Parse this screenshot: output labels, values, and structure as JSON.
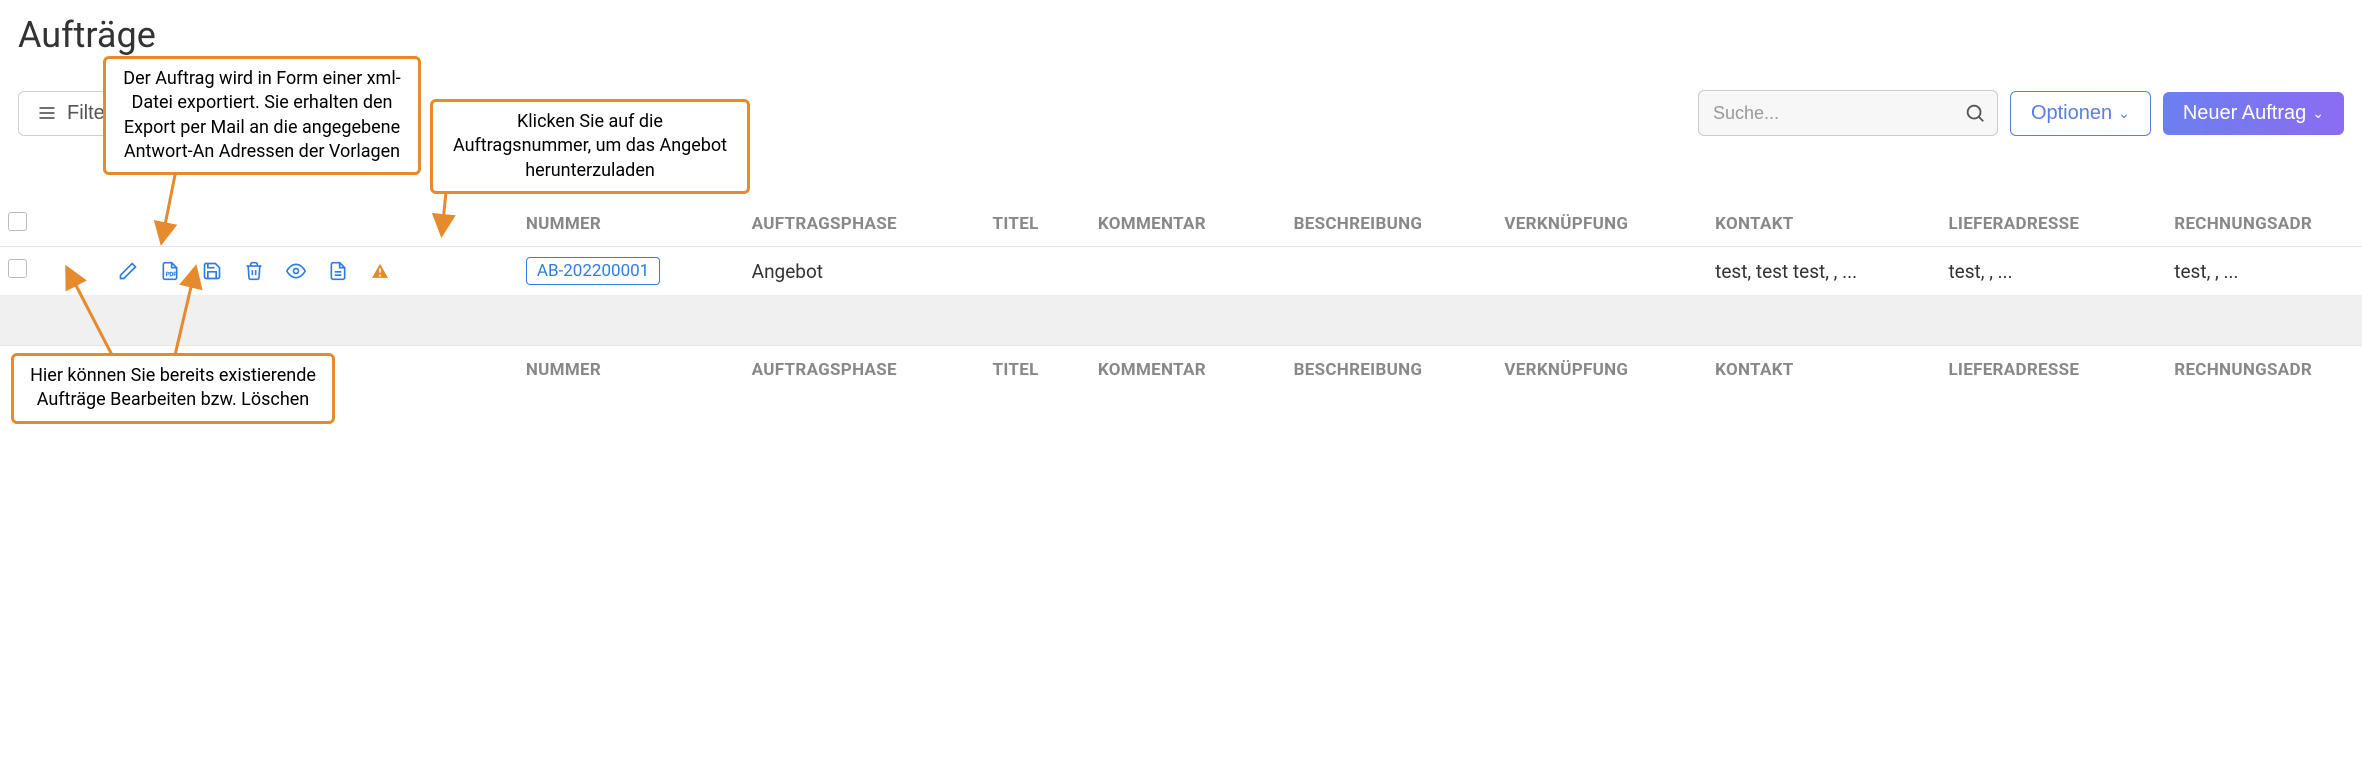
{
  "page": {
    "title": "Aufträge"
  },
  "toolbar": {
    "filter_label": "Filter"
  },
  "search": {
    "placeholder": "Suche..."
  },
  "buttons": {
    "options": "Optionen",
    "new_order": "Neuer Auftrag"
  },
  "columns": {
    "nummer": "NUMMER",
    "phase": "AUFTRAGSPHASE",
    "titel": "TITEL",
    "kommentar": "KOMMENTAR",
    "beschreibung": "BESCHREIBUNG",
    "verknuepfung": "VERKNÜPFUNG",
    "kontakt": "KONTAKT",
    "lieferadresse": "LIEFERADRESSE",
    "rechnungsadresse": "RECHNUNGSADR"
  },
  "rows": [
    {
      "nummer": "AB-202200001",
      "phase": "Angebot",
      "titel": "",
      "kommentar": "",
      "beschreibung": "",
      "verknuepfung": "",
      "kontakt": "test, test test, , ...",
      "lieferadresse": "test, , ...",
      "rechnungsadresse": "test, , ..."
    }
  ],
  "annotations": {
    "export": "Der Auftrag wird in Form einer xml-Datei exportiert. Sie erhalten den Export per Mail an die angegebene Antwort-An Adressen der Vorlagen",
    "number": "Klicken Sie auf die Auftragsnummer, um das Angebot herunterzuladen",
    "edit": "Hier können Sie bereits existierende Aufträge Bearbeiten bzw. Löschen"
  }
}
